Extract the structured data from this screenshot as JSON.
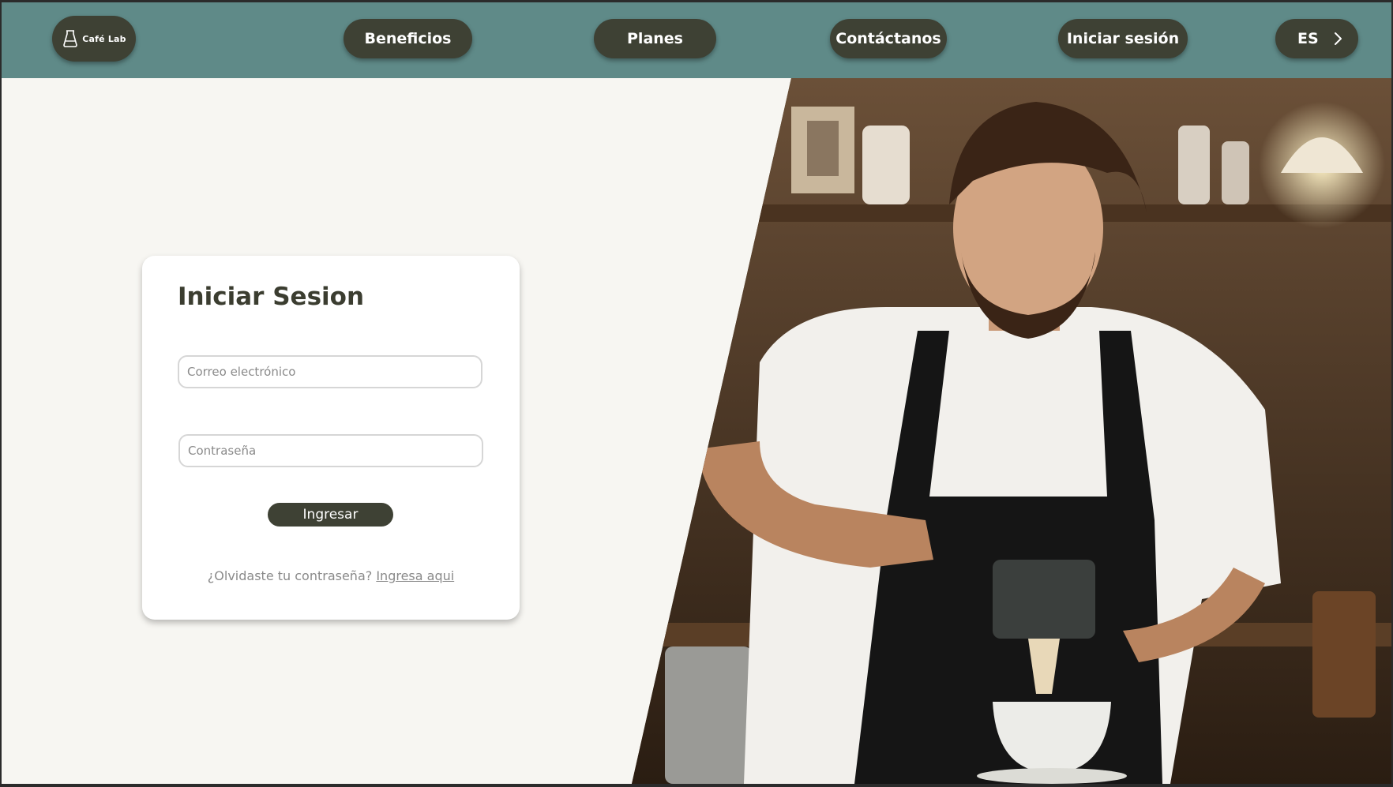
{
  "header": {
    "logo_label": "Café Lab",
    "nav": {
      "beneficios": "Beneficios",
      "planes": "Planes",
      "contactanos": "Contáctanos",
      "login": "Iniciar sesión",
      "language": "ES"
    },
    "background_color": "#5f8a88",
    "pill_color": "#3e4134"
  },
  "hero": {
    "image_subject": "barista-pouring-coffee-photo"
  },
  "login_card": {
    "title": "Iniciar Sesion",
    "email_placeholder": "Correo electrónico",
    "password_placeholder": "Contraseña",
    "submit_label": "Ingresar",
    "forgot_text": "¿Olvidaste tu contraseña?",
    "forgot_link": "Ingresa aqui"
  },
  "icons": [
    "coffee-maker-icon",
    "chevron-right-icon"
  ]
}
